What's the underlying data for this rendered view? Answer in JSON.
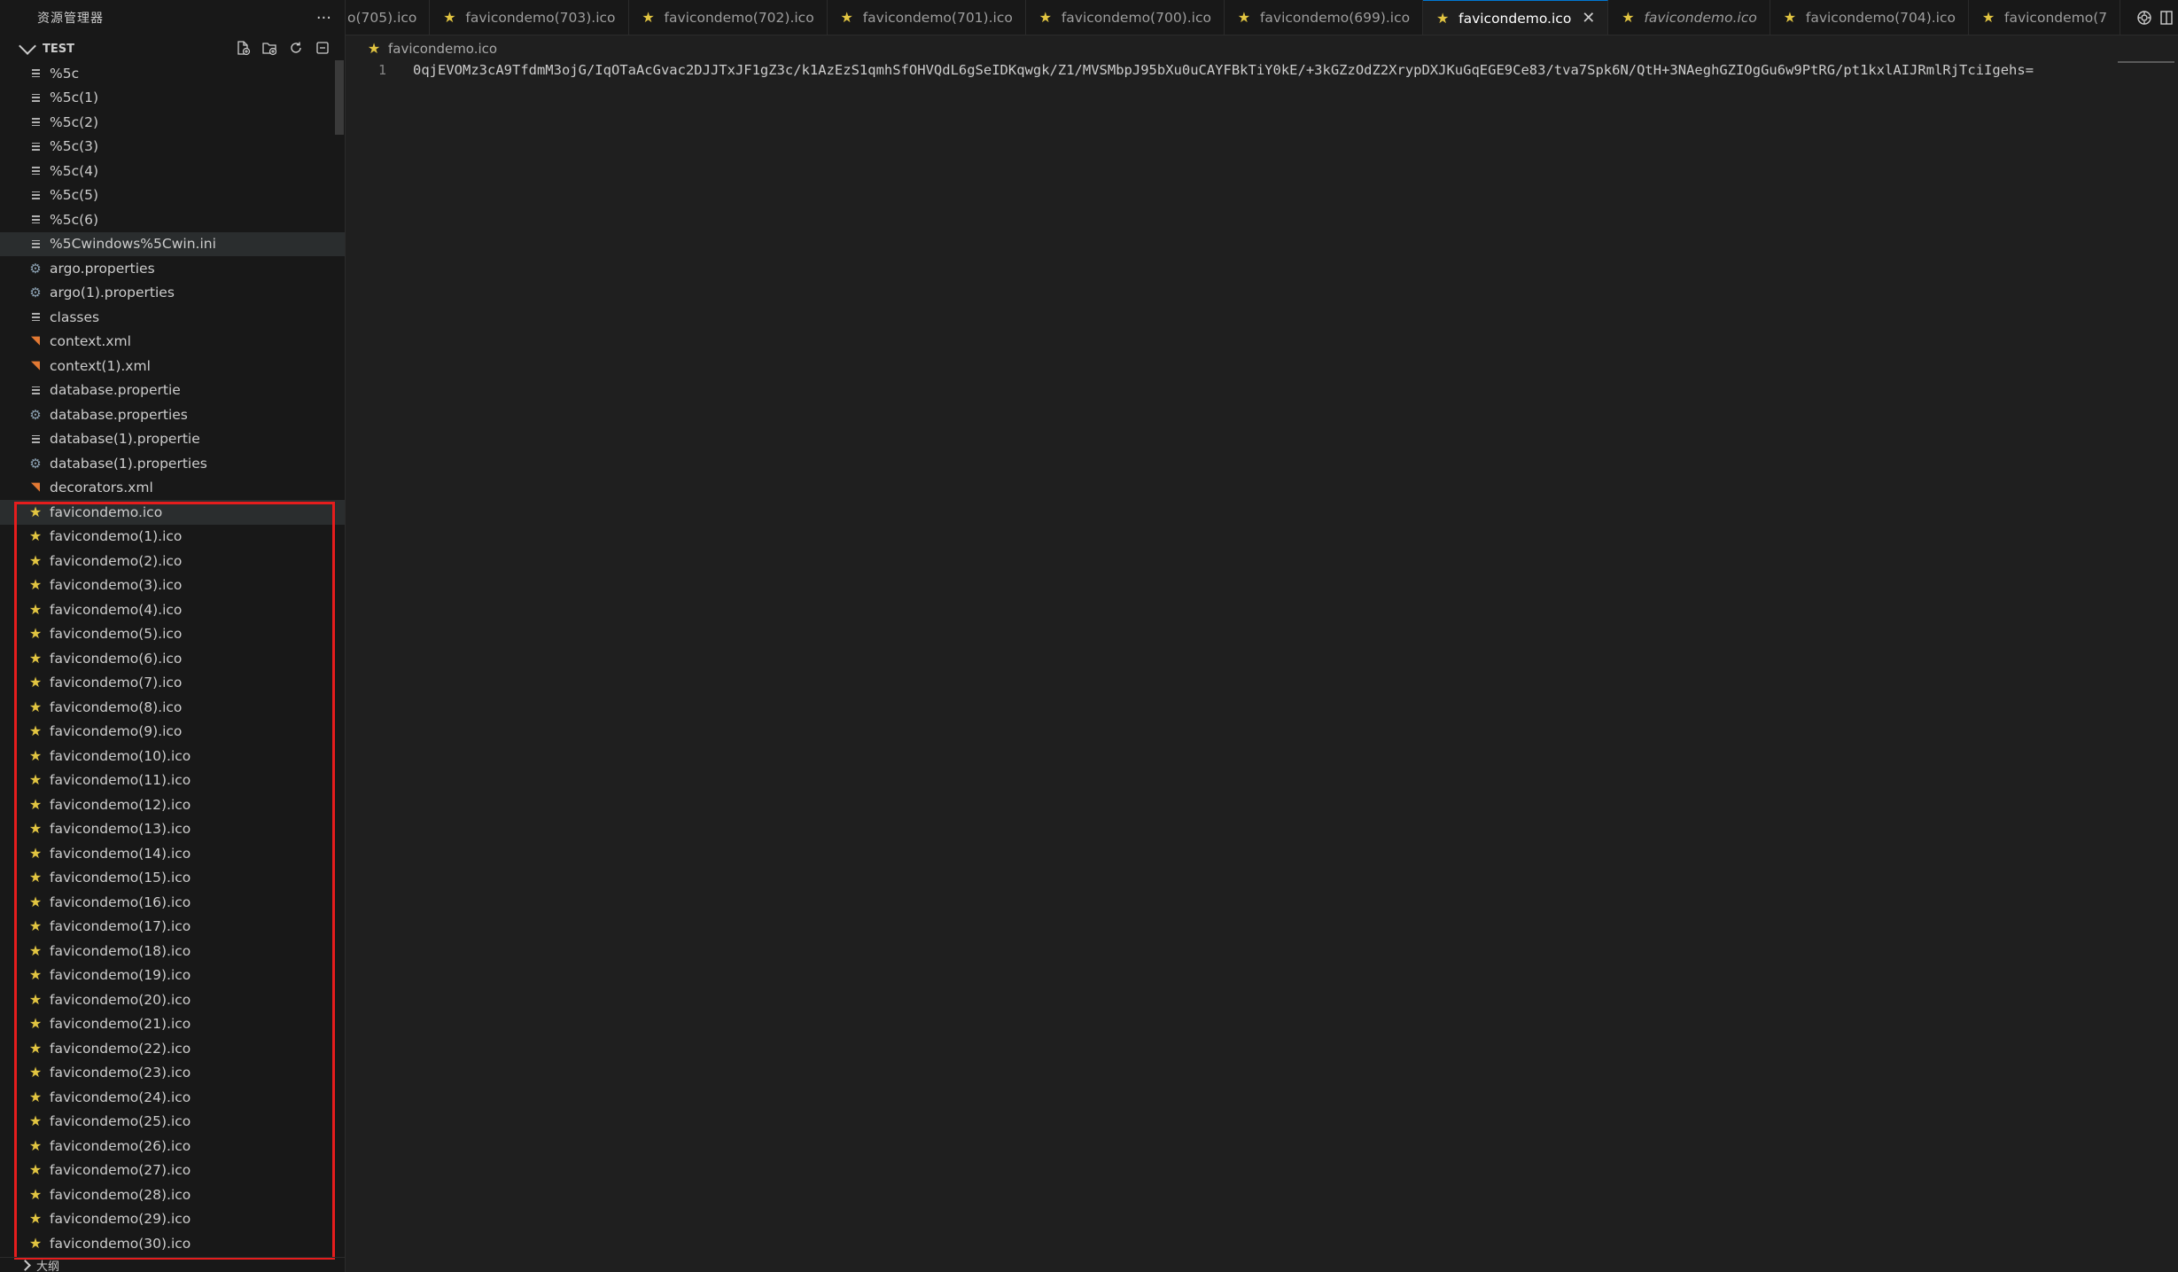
{
  "explorer": {
    "title": "资源管理器",
    "more_label": "···",
    "section_title": "TEST",
    "outline_label": "大纲"
  },
  "files": [
    {
      "name": "%5c",
      "icon": "lines"
    },
    {
      "name": "%5c(1)",
      "icon": "lines"
    },
    {
      "name": "%5c(2)",
      "icon": "lines"
    },
    {
      "name": "%5c(3)",
      "icon": "lines"
    },
    {
      "name": "%5c(4)",
      "icon": "lines"
    },
    {
      "name": "%5c(5)",
      "icon": "lines"
    },
    {
      "name": "%5c(6)",
      "icon": "lines"
    },
    {
      "name": "%5Cwindows%5Cwin.ini",
      "icon": "lines"
    },
    {
      "name": "argo.properties",
      "icon": "gear"
    },
    {
      "name": "argo(1).properties",
      "icon": "gear"
    },
    {
      "name": "classes",
      "icon": "lines"
    },
    {
      "name": "context.xml",
      "icon": "rss"
    },
    {
      "name": "context(1).xml",
      "icon": "rss"
    },
    {
      "name": "database.propertie",
      "icon": "lines"
    },
    {
      "name": "database.properties",
      "icon": "gear"
    },
    {
      "name": "database(1).propertie",
      "icon": "lines"
    },
    {
      "name": "database(1).properties",
      "icon": "gear"
    },
    {
      "name": "decorators.xml",
      "icon": "rss"
    },
    {
      "name": "favicondemo.ico",
      "icon": "star"
    },
    {
      "name": "favicondemo(1).ico",
      "icon": "star"
    },
    {
      "name": "favicondemo(2).ico",
      "icon": "star"
    },
    {
      "name": "favicondemo(3).ico",
      "icon": "star"
    },
    {
      "name": "favicondemo(4).ico",
      "icon": "star"
    },
    {
      "name": "favicondemo(5).ico",
      "icon": "star"
    },
    {
      "name": "favicondemo(6).ico",
      "icon": "star"
    },
    {
      "name": "favicondemo(7).ico",
      "icon": "star"
    },
    {
      "name": "favicondemo(8).ico",
      "icon": "star"
    },
    {
      "name": "favicondemo(9).ico",
      "icon": "star"
    },
    {
      "name": "favicondemo(10).ico",
      "icon": "star"
    },
    {
      "name": "favicondemo(11).ico",
      "icon": "star"
    },
    {
      "name": "favicondemo(12).ico",
      "icon": "star"
    },
    {
      "name": "favicondemo(13).ico",
      "icon": "star"
    },
    {
      "name": "favicondemo(14).ico",
      "icon": "star"
    },
    {
      "name": "favicondemo(15).ico",
      "icon": "star"
    },
    {
      "name": "favicondemo(16).ico",
      "icon": "star"
    },
    {
      "name": "favicondemo(17).ico",
      "icon": "star"
    },
    {
      "name": "favicondemo(18).ico",
      "icon": "star"
    },
    {
      "name": "favicondemo(19).ico",
      "icon": "star"
    },
    {
      "name": "favicondemo(20).ico",
      "icon": "star"
    },
    {
      "name": "favicondemo(21).ico",
      "icon": "star"
    },
    {
      "name": "favicondemo(22).ico",
      "icon": "star"
    },
    {
      "name": "favicondemo(23).ico",
      "icon": "star"
    },
    {
      "name": "favicondemo(24).ico",
      "icon": "star"
    },
    {
      "name": "favicondemo(25).ico",
      "icon": "star"
    },
    {
      "name": "favicondemo(26).ico",
      "icon": "star"
    },
    {
      "name": "favicondemo(27).ico",
      "icon": "star"
    },
    {
      "name": "favicondemo(28).ico",
      "icon": "star"
    },
    {
      "name": "favicondemo(29).ico",
      "icon": "star"
    },
    {
      "name": "favicondemo(30).ico",
      "icon": "star"
    }
  ],
  "highlighted_files": [
    "%5Cwindows%5Cwin.ini",
    "favicondemo.ico"
  ],
  "tabs": [
    {
      "label": "o(705).ico",
      "icon": "none",
      "active": false,
      "italic": false
    },
    {
      "label": "favicondemo(703).ico",
      "icon": "star",
      "active": false,
      "italic": false
    },
    {
      "label": "favicondemo(702).ico",
      "icon": "star",
      "active": false,
      "italic": false
    },
    {
      "label": "favicondemo(701).ico",
      "icon": "star",
      "active": false,
      "italic": false
    },
    {
      "label": "favicondemo(700).ico",
      "icon": "star",
      "active": false,
      "italic": false
    },
    {
      "label": "favicondemo(699).ico",
      "icon": "star",
      "active": false,
      "italic": false
    },
    {
      "label": "favicondemo.ico",
      "icon": "star",
      "active": true,
      "italic": false
    },
    {
      "label": "favicondemo.ico",
      "icon": "star",
      "active": false,
      "italic": true
    },
    {
      "label": "favicondemo(704).ico",
      "icon": "star",
      "active": false,
      "italic": false
    },
    {
      "label": "favicondemo(7",
      "icon": "star",
      "active": false,
      "italic": false
    }
  ],
  "tab_close_label": "✕",
  "breadcrumb": {
    "file": "favicondemo.ico"
  },
  "editor": {
    "line_number": "1",
    "content": "0qjEVOMz3cA9TfdmM3ojG/IqOTaAcGvac2DJJTxJF1gZ3c/k1AzEzS1qmhSfOHVQdL6gSeIDKqwgk/Z1/MVSMbpJ95bXu0uCAYFBkTiY0kE/+3kGZzOdZ2XrypDXJKuGqEGE9Ce83/tva7Spk6N/QtH+3NAeghGZIOgGu6w9PtRG/pt1kxlAIJRmlRjTciIgehs="
  },
  "colors": {
    "accent": "#0078d4",
    "star": "#e2c541",
    "highlight_box": "#e51d1d"
  }
}
